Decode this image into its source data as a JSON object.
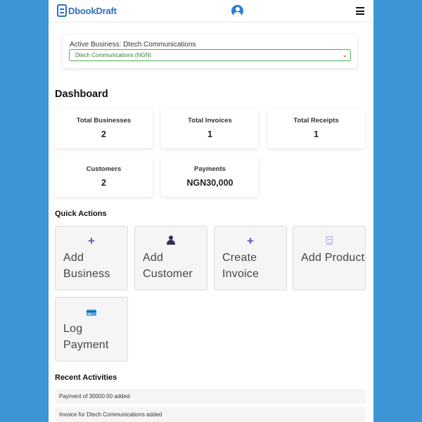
{
  "app": {
    "brand_name": "DbookDraft"
  },
  "business": {
    "active_label": "Active Business: Dtech Communications",
    "selected_option": "Dtech Communications (NGN)"
  },
  "dashboard": {
    "title": "Dashboard",
    "stats": [
      {
        "label": "Total Businesses",
        "value": "2"
      },
      {
        "label": "Total Invoices",
        "value": "1"
      },
      {
        "label": "Total Receipts",
        "value": "1"
      },
      {
        "label": "Customers",
        "value": "2"
      },
      {
        "label": "Payments",
        "value": "NGN30,000"
      }
    ]
  },
  "quick_actions": {
    "title": "Quick Actions",
    "items": [
      {
        "label": "Add Business",
        "icon": "plus-icon"
      },
      {
        "label": "Add Customer",
        "icon": "person-icon"
      },
      {
        "label": "Create Invoice",
        "icon": "plus-icon"
      },
      {
        "label": "Add Product",
        "icon": "document-icon"
      },
      {
        "label": "Log Payment",
        "icon": "credit-card-icon"
      }
    ]
  },
  "recent_activities": {
    "title": "Recent Activities",
    "items": [
      "Payment of 30000.00 added",
      "Invoice for Dtech Communications added"
    ]
  },
  "colors": {
    "background": "#3d95d6",
    "brand": "#2e6fc4",
    "accent_icon": "#6a4fc0",
    "select_border": "#4caf50"
  }
}
